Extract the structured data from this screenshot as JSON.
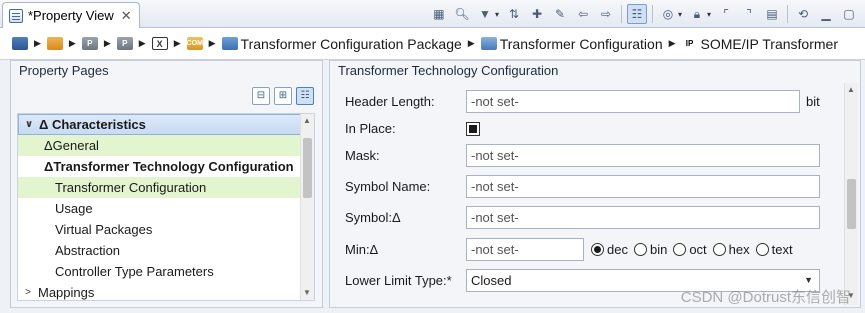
{
  "view_tab": {
    "label": "*Property View",
    "close": "✕"
  },
  "toolbar": {
    "buttons": [
      "table-icon",
      "search-icon",
      "filter-icon",
      "sync-icon",
      "new-icon",
      "edit-icon",
      "back-icon",
      "forward-icon",
      "tree-icon",
      "target-icon",
      "lock-icon",
      "ref-icon",
      "ref2-icon",
      "doc-icon",
      "link-icon",
      "minimize-icon",
      "maximize-icon"
    ]
  },
  "breadcrumb": {
    "items": [
      {
        "icon": "",
        "label": ""
      },
      {
        "icon": "",
        "label": ""
      },
      {
        "icon": "P",
        "label": ""
      },
      {
        "icon": "P",
        "label": ""
      },
      {
        "icon": "X",
        "label": ""
      },
      {
        "icon": "COM",
        "label": ""
      },
      {
        "icon": "",
        "label": "Transformer Configuration Package"
      },
      {
        "icon": "",
        "label": "Transformer Configuration"
      },
      {
        "icon": "IP",
        "label": "SOME/IP Transformer"
      }
    ]
  },
  "left_panel": {
    "title": "Property Pages",
    "tree": [
      {
        "label": "Δ Characteristics",
        "twisty": "∨",
        "style": "selected bold",
        "indent": 4
      },
      {
        "label": "ΔGeneral",
        "twisty": "",
        "style": "hl",
        "indent": 26
      },
      {
        "label": "ΔTransformer Technology Configuration",
        "twisty": "",
        "style": "bold",
        "indent": 26
      },
      {
        "label": "Transformer Configuration",
        "twisty": "",
        "style": "hl",
        "indent": 37
      },
      {
        "label": "Usage",
        "twisty": "",
        "style": "",
        "indent": 37
      },
      {
        "label": "Virtual Packages",
        "twisty": "",
        "style": "",
        "indent": 37
      },
      {
        "label": "Abstraction",
        "twisty": "",
        "style": "",
        "indent": 37
      },
      {
        "label": "Controller Type Parameters",
        "twisty": "",
        "style": "",
        "indent": 37
      },
      {
        "label": "Mappings",
        "twisty": ">",
        "style": "",
        "indent": 4
      }
    ]
  },
  "right_panel": {
    "title": "Transformer Technology Configuration",
    "fields": {
      "header_length": {
        "label": "Header Length:",
        "value": "-not set-",
        "unit": "bit"
      },
      "in_place": {
        "label": "In Place:"
      },
      "mask": {
        "label": "Mask:",
        "value": "-not set-"
      },
      "symbol_name": {
        "label": "Symbol Name:",
        "value": "-not set-"
      },
      "symbol": {
        "label": "Symbol:Δ",
        "value": "-not set-"
      },
      "min": {
        "label": "Min:Δ",
        "value": "-not set-"
      },
      "lower_limit_type": {
        "label": "Lower Limit Type:*",
        "value": "Closed"
      }
    },
    "radix_options": [
      {
        "label": "dec",
        "checked": true
      },
      {
        "label": "bin",
        "checked": false
      },
      {
        "label": "oct",
        "checked": false
      },
      {
        "label": "hex",
        "checked": false
      },
      {
        "label": "text",
        "checked": false
      }
    ]
  },
  "watermark": "CSDN @Dotrust东信创智"
}
